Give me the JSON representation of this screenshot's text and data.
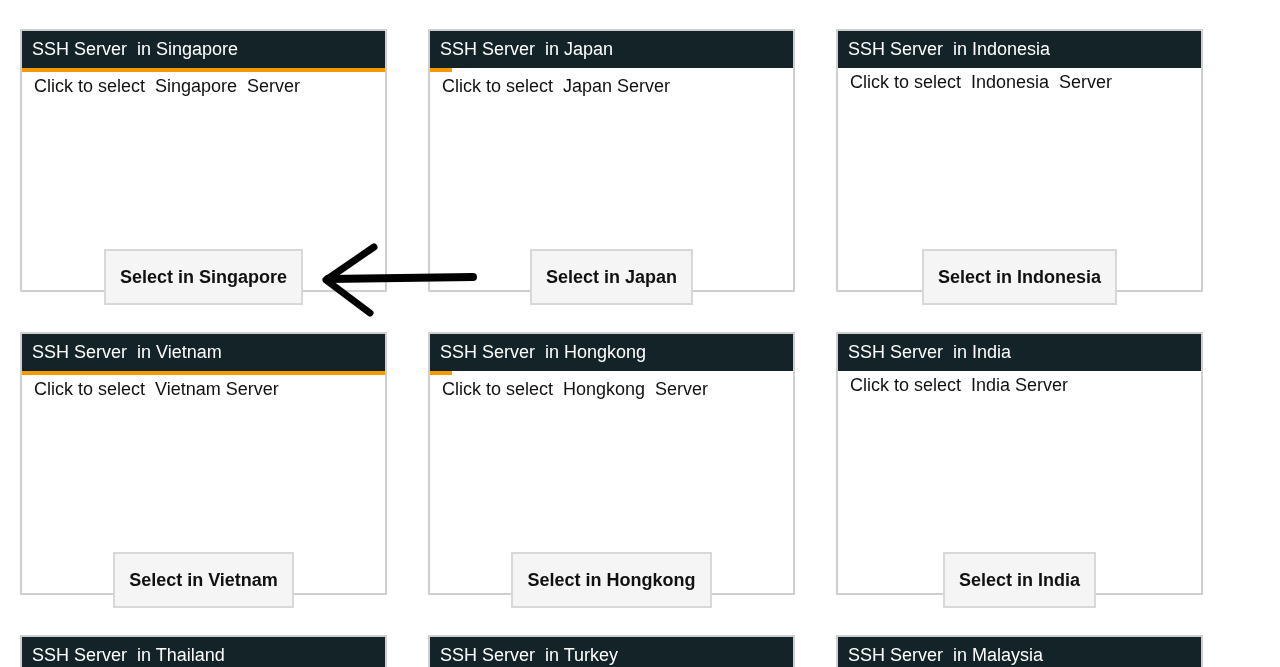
{
  "servers": [
    {
      "title": "SSH Server  in Singapore",
      "level": 1,
      "description": "Click to select  Singapore  Server",
      "button": "Select in Singapore"
    },
    {
      "title": "SSH Server  in Japan",
      "level": 0.06,
      "description": "Click to select  Japan Server",
      "button": "Select in Japan"
    },
    {
      "title": "SSH Server  in Indonesia",
      "description": "Click to select  Indonesia  Server",
      "button": "Select in Indonesia"
    },
    {
      "title": "SSH Server  in Vietnam",
      "level": 1,
      "description": "Click to select  Vietnam Server",
      "button": "Select in Vietnam"
    },
    {
      "title": "SSH Server  in Hongkong",
      "level": 0.06,
      "description": "Click to select  Hongkong  Server",
      "button": "Select in Hongkong"
    },
    {
      "title": "SSH Server  in India",
      "description": "Click to select  India Server",
      "button": "Select in India"
    },
    {
      "title": "SSH Server  in Thailand"
    },
    {
      "title": "SSH Server  in Turkey"
    },
    {
      "title": "SSH Server  in Malaysia"
    }
  ]
}
